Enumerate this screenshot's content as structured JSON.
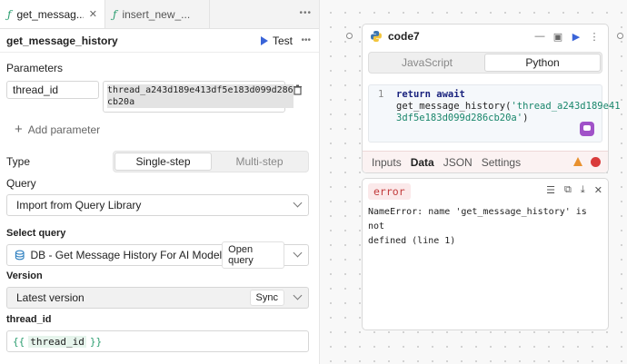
{
  "tabs": [
    {
      "label": "get_messag...",
      "active": true
    },
    {
      "label": "insert_new_...",
      "active": false
    }
  ],
  "header": {
    "title": "get_message_history",
    "test_label": "Test"
  },
  "parameters": {
    "heading": "Parameters",
    "param_name": "thread_id",
    "param_value_line1": "thread_a243d189e413df5e183d099d286",
    "param_value_line2": "cb20a",
    "add_label": "Add parameter"
  },
  "type": {
    "label": "Type",
    "options": [
      "Single-step",
      "Multi-step"
    ],
    "selected": "Single-step"
  },
  "query": {
    "label": "Query",
    "value": "Import from Query Library"
  },
  "select_query": {
    "label": "Select query",
    "value": "DB - Get Message History For AI Model",
    "open_label": "Open query"
  },
  "version": {
    "label": "Version",
    "value": "Latest version",
    "sync_label": "Sync"
  },
  "thread_id_field": {
    "label": "thread_id",
    "open": "{{",
    "var": "thread_id",
    "close": "}}"
  },
  "node": {
    "name": "code7",
    "languages": [
      "JavaScript",
      "Python"
    ],
    "selected_language": "Python",
    "line_number": "1",
    "code_kw": "return await",
    "code_call": "get_message_history(",
    "code_str1": "'thread_a243d189e41",
    "code_str2": "3df5e183d099d286cb20a'",
    "code_close": ")",
    "result_tabs": [
      "Inputs",
      "Data",
      "JSON",
      "Settings"
    ],
    "selected_result_tab": "Data"
  },
  "result": {
    "badge": "error",
    "message_line1": "NameError: name 'get_message_history' is not",
    "message_line2": "defined (line 1)"
  },
  "colors": {
    "accent": "#3a64d8",
    "error": "#d93b3b",
    "warning": "#e8912f",
    "fx": "#2a9d6f"
  }
}
